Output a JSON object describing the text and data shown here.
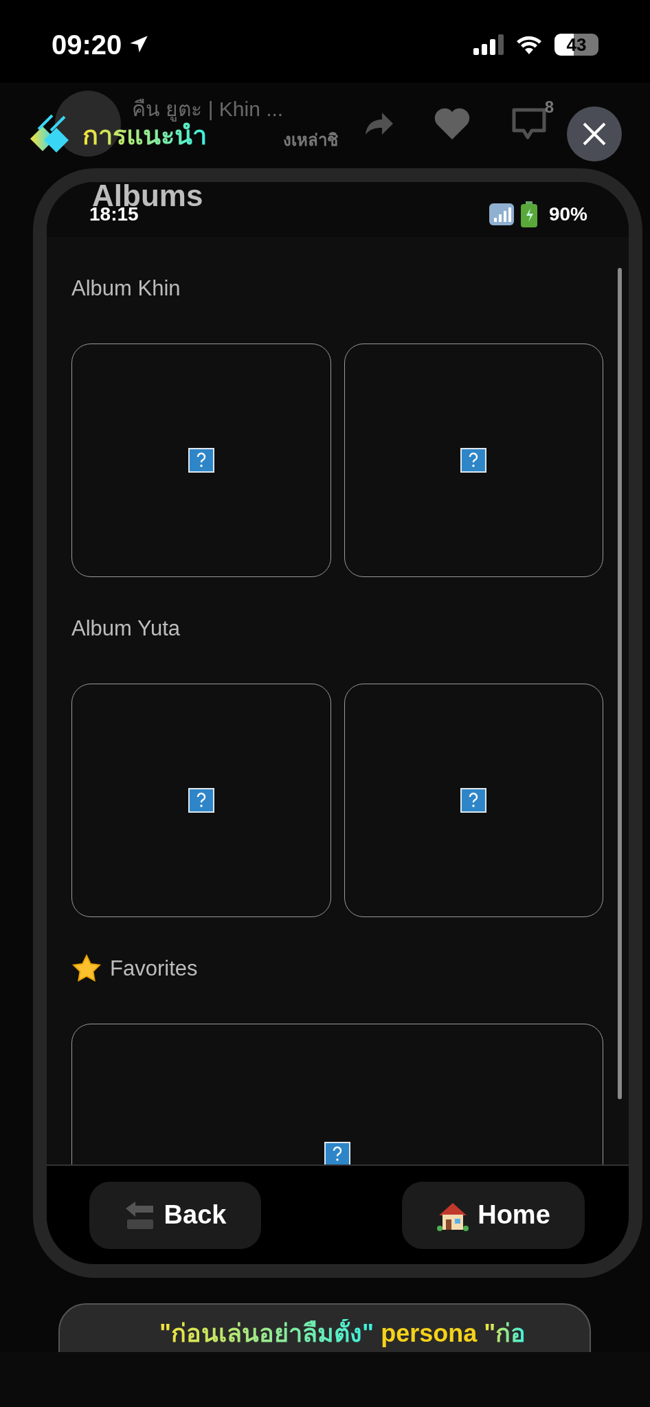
{
  "status_bar": {
    "time": "09:20",
    "battery": "43"
  },
  "background_header": {
    "title": "คืน ยูตะ | Khin ...",
    "subtitle": "งเหล่าชิ",
    "comment_count": "8"
  },
  "overlay": {
    "title": "การแนะนำ"
  },
  "phone": {
    "page_title": "Albums",
    "time": "18:15",
    "battery": "90%",
    "sections": [
      {
        "title": "Album Khin",
        "starred": false,
        "items": [
          {
            "kind": "broken-image"
          },
          {
            "kind": "broken-image"
          }
        ]
      },
      {
        "title": "Album Yuta",
        "starred": false,
        "items": [
          {
            "kind": "broken-image"
          },
          {
            "kind": "broken-image"
          }
        ]
      },
      {
        "title": "Favorites",
        "starred": true,
        "items": [
          {
            "kind": "broken-image-wide"
          }
        ]
      }
    ],
    "nav": [
      {
        "label": "Back",
        "kind": "back"
      },
      {
        "label": "Home",
        "kind": "home"
      }
    ]
  },
  "footer_card": {
    "parts": [
      {
        "text": "\"ก่อนเล่นอย่าลืมตั้ง\"",
        "kind": "gradient"
      },
      {
        "text": "persona",
        "kind": "highlight"
      },
      {
        "text": "\"ก่อ",
        "kind": "gradient"
      }
    ]
  }
}
